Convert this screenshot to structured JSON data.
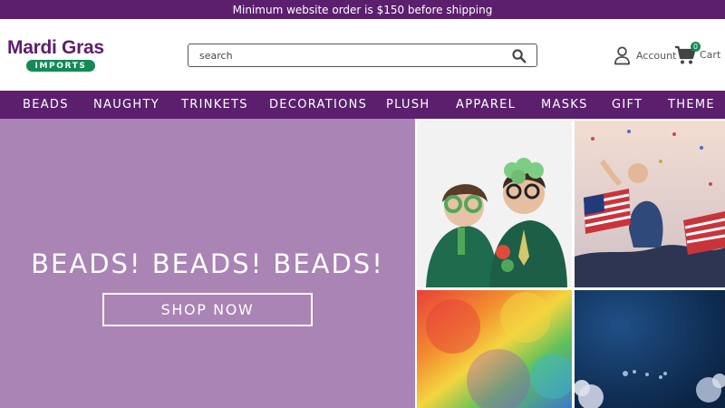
{
  "announcement": "Minimum website order is $150 before shipping",
  "logo": {
    "top": "Mardi Gras",
    "bottom": "IMPORTS"
  },
  "search": {
    "placeholder": "search",
    "value": ""
  },
  "account": {
    "label": "Account"
  },
  "cart": {
    "label": "Cart",
    "count": "0"
  },
  "nav": {
    "items": [
      {
        "label": "BEADS"
      },
      {
        "label": "NAUGHTY"
      },
      {
        "label": "TRINKETS"
      },
      {
        "label": "DECORATIONS"
      },
      {
        "label": "PLUSH"
      },
      {
        "label": "APPAREL"
      },
      {
        "label": "MASKS"
      },
      {
        "label": "GIFT"
      },
      {
        "label": "THEME"
      }
    ]
  },
  "hero": {
    "title": "BEADS! BEADS! BEADS!",
    "button": "SHOP NOW"
  },
  "icons": [
    "search-icon",
    "user-icon",
    "cart-icon"
  ],
  "colors": {
    "brand_purple": "#5b1f6e",
    "hero_purple": "#a984b4",
    "accent_green": "#128a57"
  }
}
